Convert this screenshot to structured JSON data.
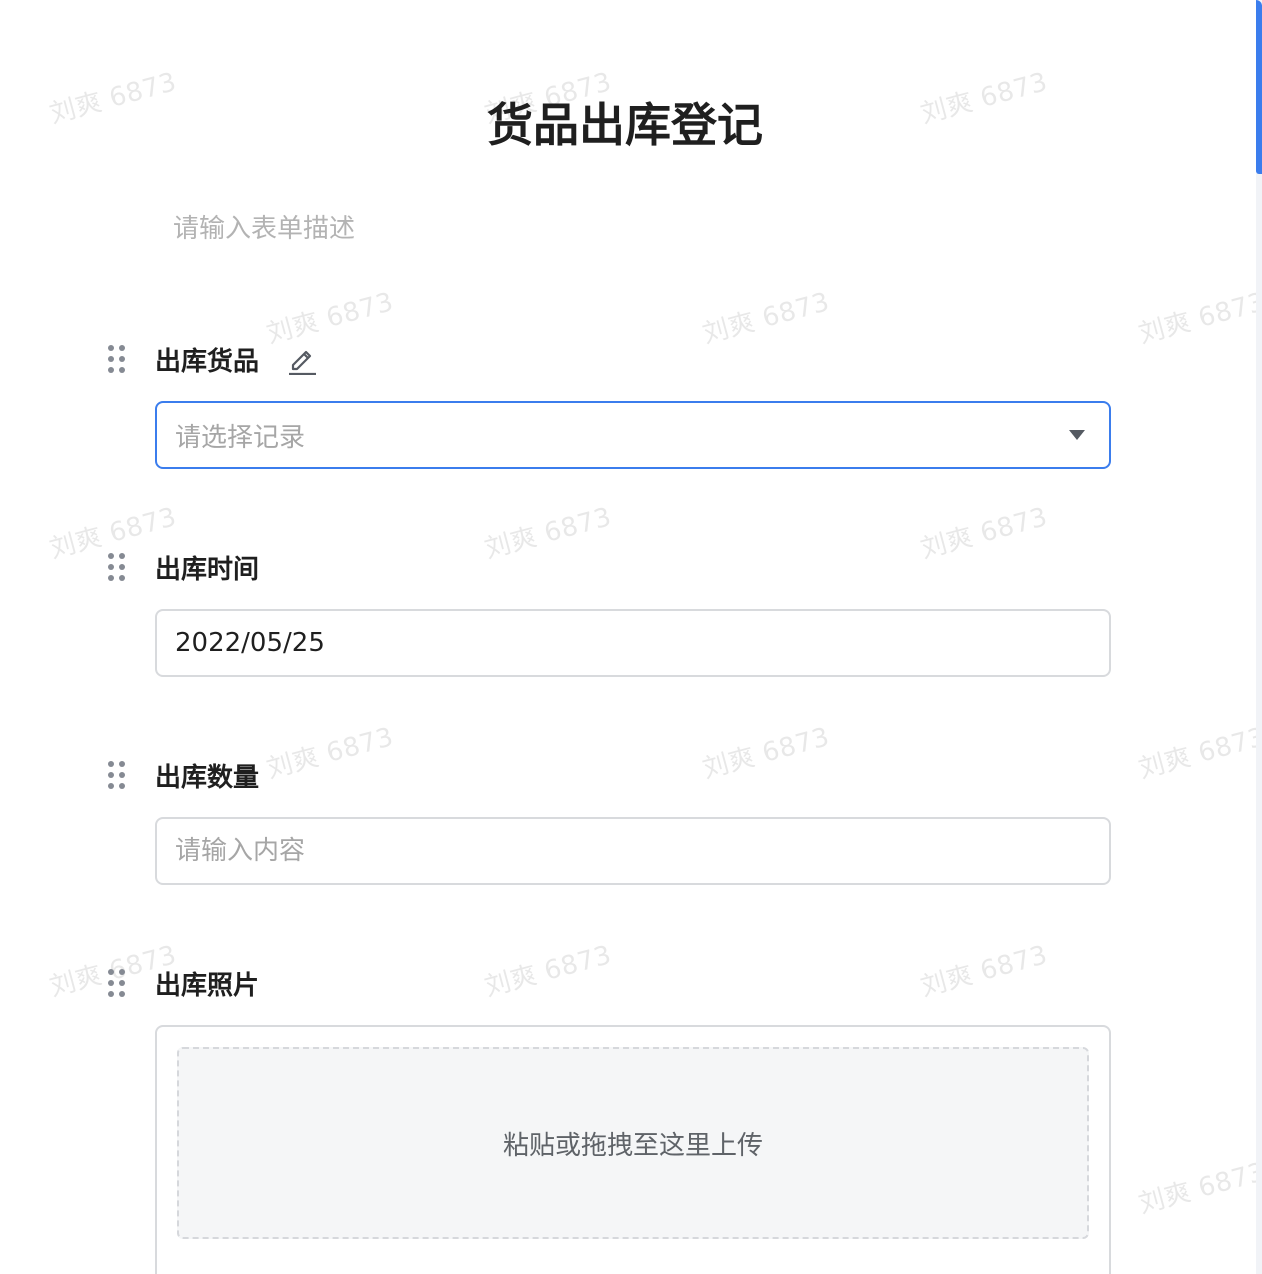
{
  "watermark": {
    "text": "刘爽 6873"
  },
  "form": {
    "title": "货品出库登记",
    "description_placeholder": "请输入表单描述"
  },
  "fields": [
    {
      "label": "出库货品",
      "type": "record-select",
      "placeholder": "请选择记录",
      "value": "",
      "focused": true,
      "icons": [
        "drag-icon",
        "pencil-icon",
        "caret-down-icon"
      ]
    },
    {
      "label": "出库时间",
      "type": "date",
      "placeholder": "",
      "value": "2022/05/25"
    },
    {
      "label": "出库数量",
      "type": "text",
      "placeholder": "请输入内容",
      "value": ""
    },
    {
      "label": "出库照片",
      "type": "upload",
      "dropzone_text": "粘贴或拖拽至这里上传"
    }
  ],
  "colors": {
    "accent": "#3b7ded",
    "border": "#d8dadd",
    "placeholder": "#a6a6a6",
    "label": "#1f1f1f"
  }
}
